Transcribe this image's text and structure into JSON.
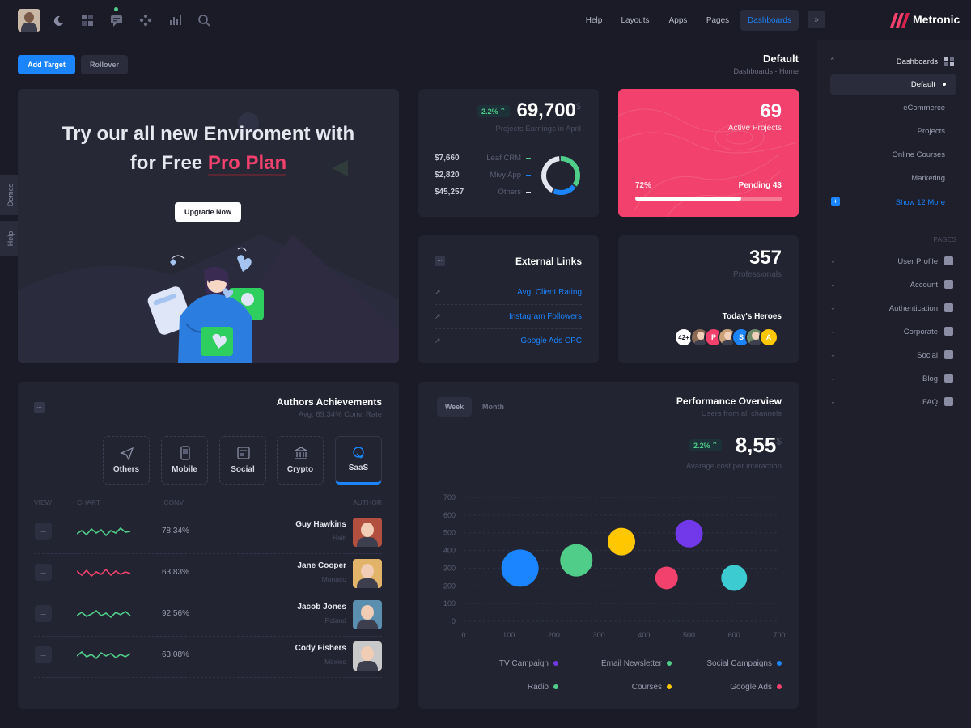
{
  "header": {
    "nav": [
      "Help",
      "Layouts",
      "Apps",
      "Pages",
      "Dashboards"
    ],
    "active_nav": "Dashboards",
    "brand": "Metronic"
  },
  "toolbar": {
    "add_target": "Add Target",
    "rollover": "Rollover",
    "page_title": "Default",
    "breadcrumb": [
      "Dashboards",
      "Home"
    ]
  },
  "side_tabs": [
    "Demos",
    "Help"
  ],
  "promo": {
    "line1": "Try our all new Enviroment with",
    "line2_prefix": "for Free ",
    "line2_accent": "Pro Plan",
    "button": "Upgrade Now"
  },
  "earnings": {
    "badge": "2.2%",
    "value": "69,700",
    "currency": "$",
    "subtitle": "Projects Earnings in April",
    "items": [
      {
        "amount": "$7,660",
        "label": "Leaf CRM",
        "color": "#50cd89"
      },
      {
        "amount": "$2,820",
        "label": "Mivy App",
        "color": "#1b84ff"
      },
      {
        "amount": "$45,257",
        "label": "Others",
        "color": "#e4e6ef"
      }
    ]
  },
  "active_projects": {
    "value": "69",
    "label": "Active Projects",
    "percent_label": "72%",
    "pending": "Pending 43",
    "progress": 0.72
  },
  "external_links": {
    "title": "External Links",
    "links": [
      "Avg. Client Rating",
      "Instagram Followers",
      "Google Ads CPC"
    ]
  },
  "professionals": {
    "value": "357",
    "label": "Professionals",
    "heroes_title": "Today's Heroes",
    "more": "42+",
    "avatars": [
      {
        "type": "photo",
        "bg": "#8a6a55"
      },
      {
        "type": "letter",
        "letter": "P",
        "bg": "#f1416c"
      },
      {
        "type": "photo",
        "bg": "#c9a27a"
      },
      {
        "type": "letter",
        "letter": "S",
        "bg": "#1b84ff"
      },
      {
        "type": "photo",
        "bg": "#6d8a6a"
      },
      {
        "type": "letter",
        "letter": "A",
        "bg": "#ffc700"
      }
    ]
  },
  "authors": {
    "title": "Authors Achievements",
    "subtitle": "Avg. 69.34% Conv. Rate",
    "categories": [
      "Others",
      "Mobile",
      "Social",
      "Crypto",
      "SaaS"
    ],
    "active_category": "SaaS",
    "columns": [
      "VIEW",
      "CHART",
      ".CONV",
      "AUTHOR"
    ],
    "rows": [
      {
        "conv": "78.34%",
        "name": "Guy Hawkins",
        "country": "Haiti",
        "spark": "#50cd89",
        "avatar": "#b34f3f"
      },
      {
        "conv": "63.83%",
        "name": "Jane Cooper",
        "country": "Monaco",
        "spark": "#f1416c",
        "avatar": "#e2b46a"
      },
      {
        "conv": "92.56%",
        "name": "Jacob Jones",
        "country": "Poland",
        "spark": "#50cd89",
        "avatar": "#5b8fb0"
      },
      {
        "conv": "63.08%",
        "name": "Cody Fishers",
        "country": "Mexico",
        "spark": "#50cd89",
        "avatar": "#c9c9c9"
      }
    ]
  },
  "performance": {
    "tabs": [
      "Week",
      "Month"
    ],
    "active_tab": "Week",
    "title": "Performance Overview",
    "subtitle": "Users from all channels",
    "badge": "2.2%",
    "value": "8,55",
    "currency": "$",
    "caption": "Avarage cost per interaction"
  },
  "chart_data": {
    "type": "scatter",
    "x_ticks": [
      "0",
      "100",
      "200",
      "300",
      "400",
      "500",
      "600",
      "700"
    ],
    "y_ticks": [
      "0",
      "100",
      "200",
      "300",
      "400",
      "500",
      "600",
      "700"
    ],
    "xlim": [
      0,
      700
    ],
    "ylim": [
      0,
      700
    ],
    "grid": true,
    "series": [
      {
        "name": "Social Campaigns",
        "color": "#1b84ff",
        "x": 125,
        "y": 300,
        "size": 46
      },
      {
        "name": "Email Newsletter",
        "color": "#50cd89",
        "x": 250,
        "y": 345,
        "size": 40
      },
      {
        "name": "Courses",
        "color": "#ffc700",
        "x": 350,
        "y": 450,
        "size": 34
      },
      {
        "name": "Google Ads",
        "color": "#f1416c",
        "x": 450,
        "y": 245,
        "size": 28
      },
      {
        "name": "TV Campaign",
        "color": "#7239ea",
        "x": 500,
        "y": 495,
        "size": 34
      },
      {
        "name": "Radio",
        "color": "#3ccbd1",
        "x": 600,
        "y": 245,
        "size": 32
      }
    ],
    "legend": [
      {
        "label": "TV Campaign",
        "color": "#7239ea"
      },
      {
        "label": "Email Newsletter",
        "color": "#50cd89"
      },
      {
        "label": "Social Campaigns",
        "color": "#1b84ff"
      },
      {
        "label": "Radio",
        "color": "#50cd89"
      },
      {
        "label": "Courses",
        "color": "#ffc700"
      },
      {
        "label": "Google Ads",
        "color": "#f1416c"
      }
    ],
    "legend_placement": "bottom"
  },
  "sidebar": {
    "section_title": "Dashboards",
    "items": [
      "Default",
      "eCommerce",
      "Projects",
      "Online Courses",
      "Marketing"
    ],
    "active_item": "Default",
    "show_more": "Show 12 More",
    "pages_heading": "PAGES",
    "pages": [
      "User Profile",
      "Account",
      "Authentication",
      "Corporate",
      "Social",
      "Blog",
      "FAQ"
    ]
  },
  "colors": {
    "bg": "#1a1b26",
    "card": "#222431",
    "primary": "#1b84ff",
    "danger": "#f1416c",
    "success": "#50cd89"
  }
}
